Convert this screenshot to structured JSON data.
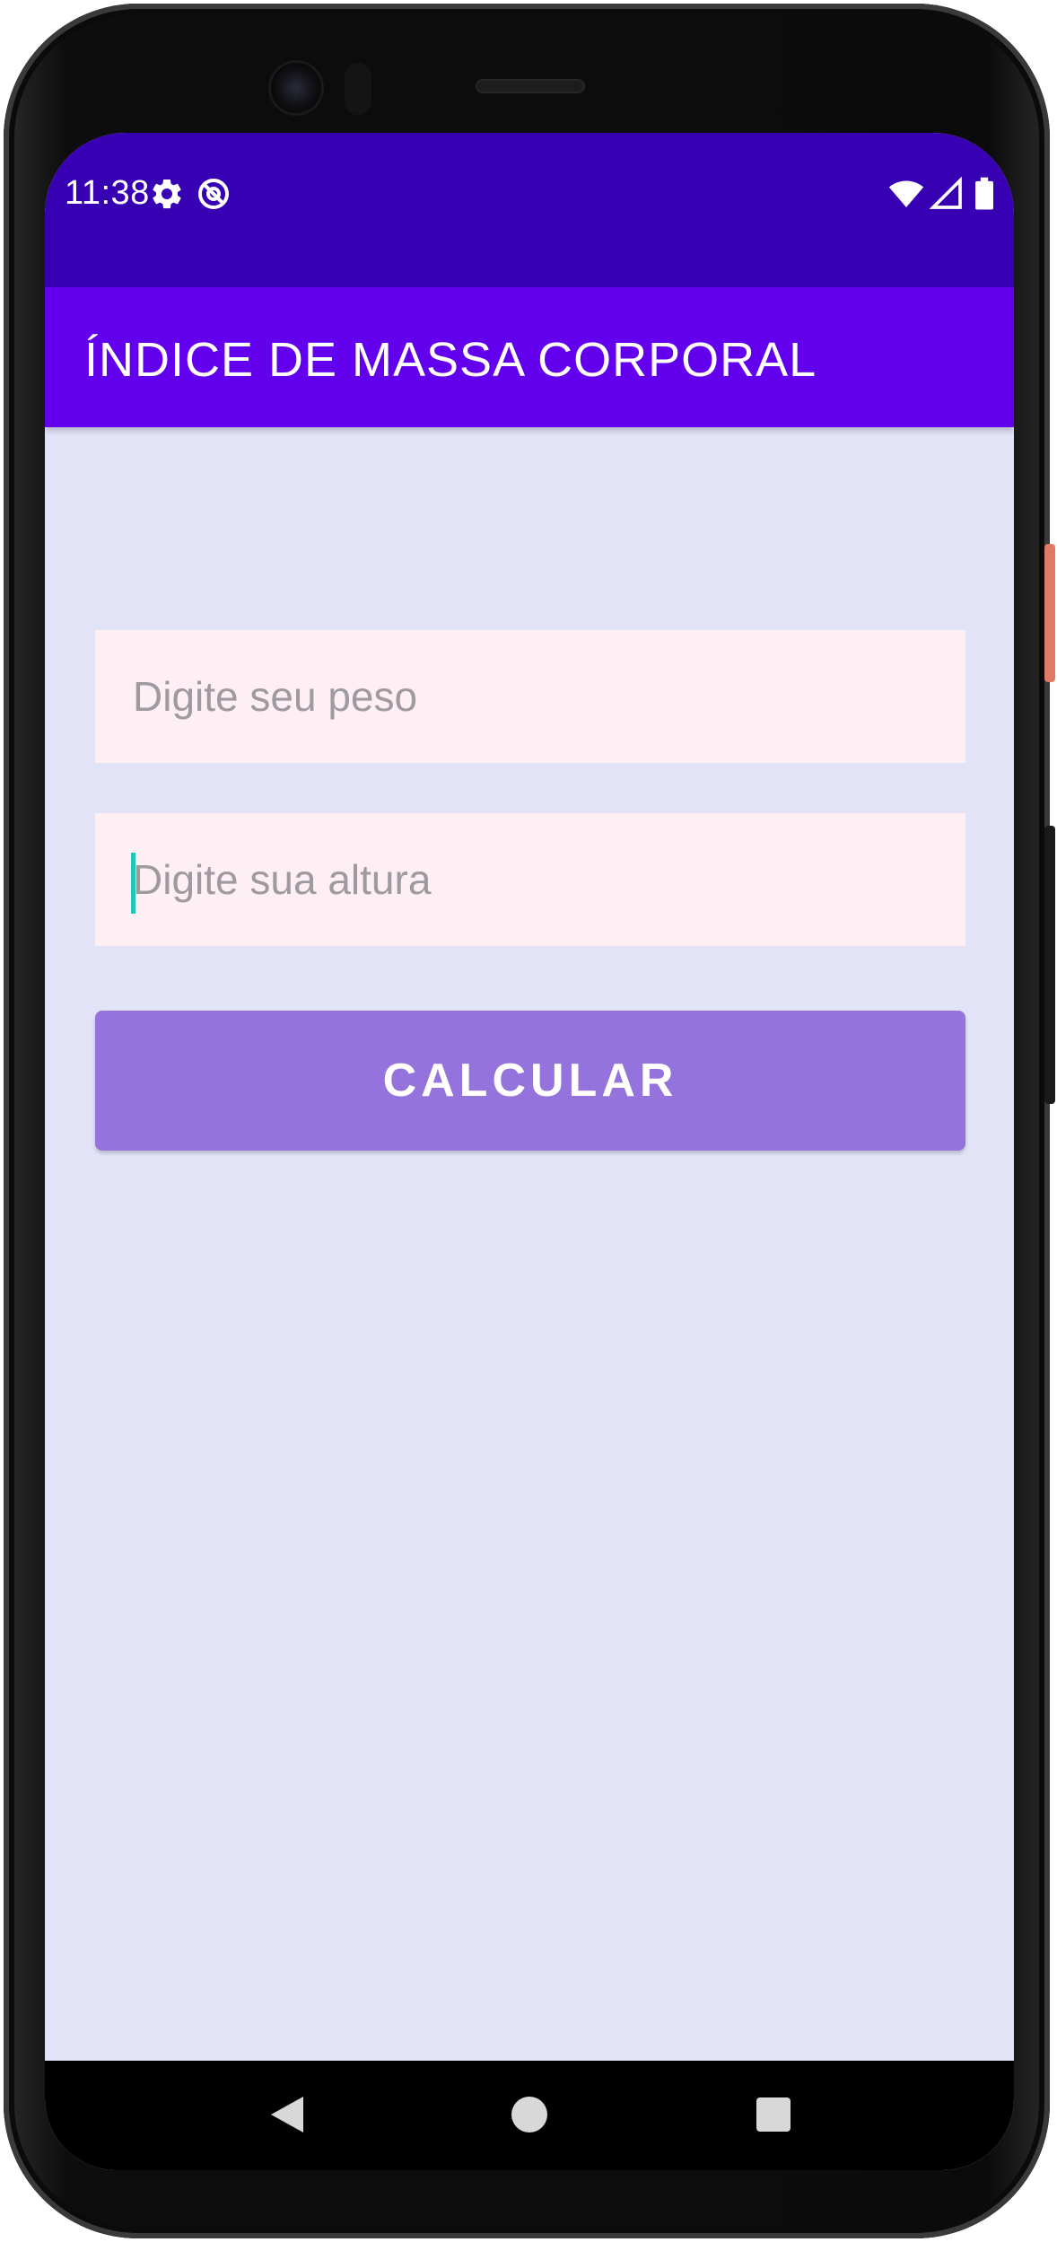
{
  "status_bar": {
    "time": "11:38",
    "icons": [
      "settings-icon",
      "at-icon",
      "wifi-icon",
      "signal-icon",
      "battery-icon"
    ]
  },
  "app_bar": {
    "title": "ÍNDICE DE MASSA CORPORAL"
  },
  "form": {
    "weight_placeholder": "Digite seu peso",
    "weight_value": "",
    "height_placeholder": "Digite sua altura",
    "height_value": "",
    "calculate_label": "CALCULAR"
  },
  "nav_bar": {
    "buttons": [
      "back-icon",
      "home-icon",
      "recents-icon"
    ]
  },
  "colors": {
    "status_bar": "#3700b3",
    "app_bar": "#6200ee",
    "background": "#e3e3f8",
    "field_background": "#fdeff4",
    "button": "#9473dc",
    "cursor": "#1fc7b8"
  }
}
